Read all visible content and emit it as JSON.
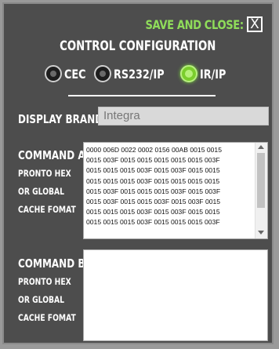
{
  "header": {
    "save_close_label": "SAVE AND CLOSE:",
    "close_symbol": "X",
    "title": "CONTROL CONFIGURATION"
  },
  "protocols": [
    {
      "label": "CEC",
      "selected": false
    },
    {
      "label": "RS232/IP",
      "selected": false
    },
    {
      "label": "IR/IP",
      "selected": true
    }
  ],
  "display_brand": {
    "label": "DISPLAY BRAND:",
    "value": "Integra"
  },
  "command_a": {
    "label": "COMMAND A:",
    "hint_lines": [
      "PRONTO HEX",
      "OR GLOBAL",
      "CACHE FOMAT"
    ],
    "value": "0000 006D 0022 0002 0156 00AB 0015 0015\n0015 003F 0015 0015 0015 0015 0015 003F\n0015 0015 0015 003F 0015 003F 0015 0015\n0015 0015 0015 003F 0015 0015 0015 0015\n0015 003F 0015 0015 0015 003F 0015 003F\n0015 003F 0015 0015 003F 0015 003F 0015\n0015 0015 0015 003F 0015 003F 0015 0015\n0015 0015 0015 003F 0015 0015 0015 003F"
  },
  "command_b": {
    "label": "COMMAND B:",
    "hint_lines": [
      "PRONTO HEX",
      "OR GLOBAL",
      "CACHE FOMAT"
    ],
    "value": ""
  },
  "colors": {
    "accent_green": "#8fdc5a",
    "panel_bg": "#4d4d4d"
  }
}
